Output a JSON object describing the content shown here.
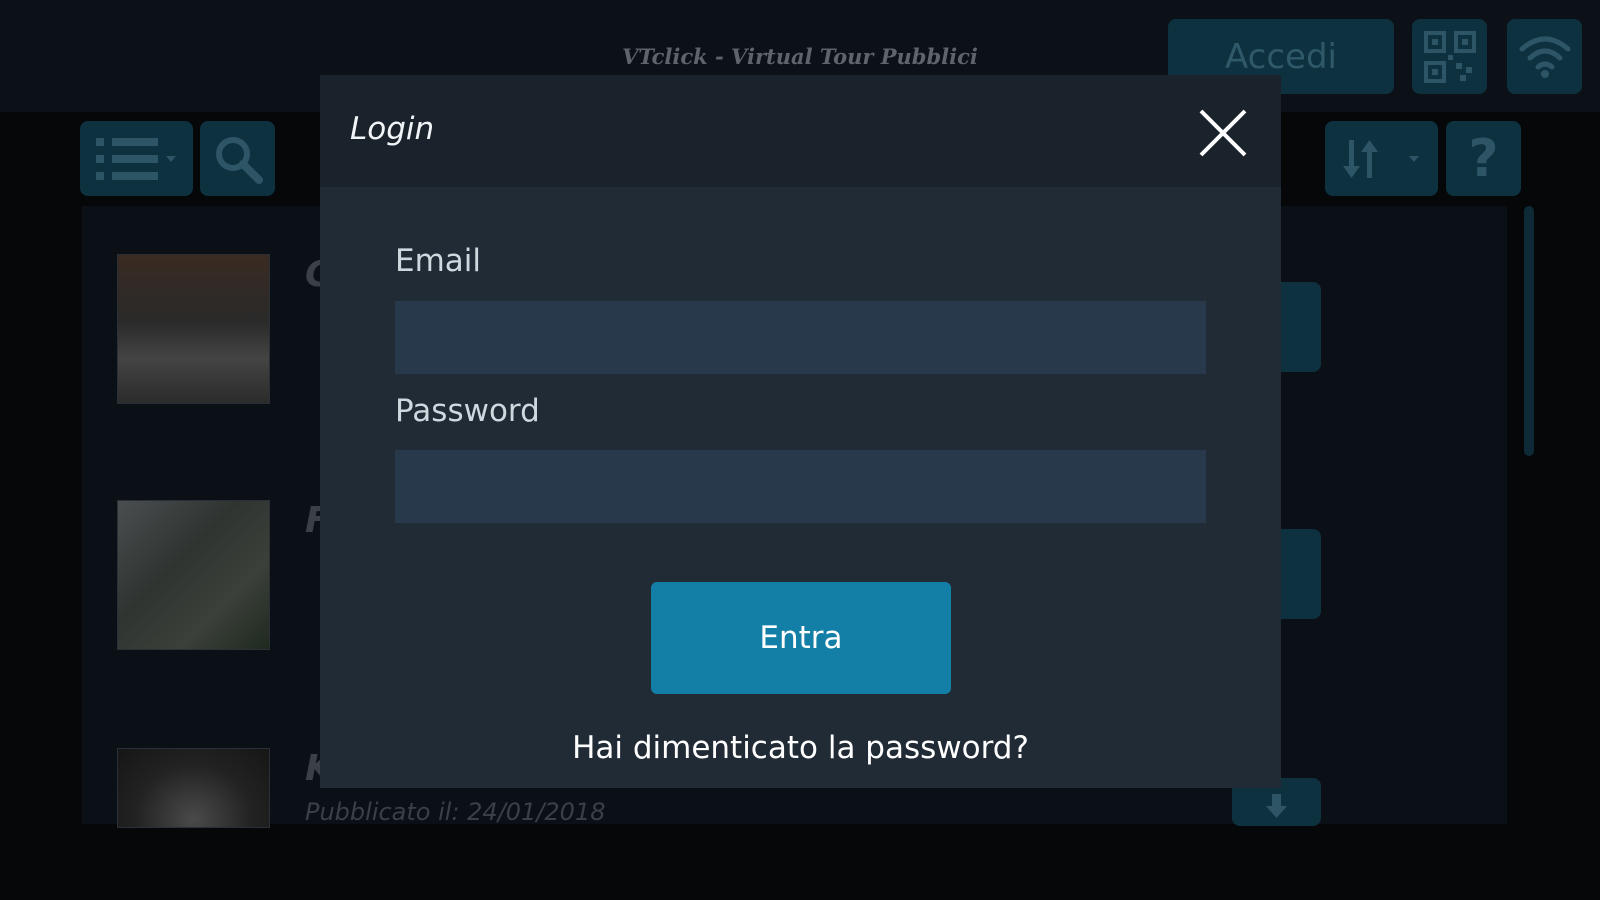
{
  "app": {
    "title": "VTclick - Virtual Tour Pubblici",
    "accedi_label": "Accedi",
    "help_label": "?",
    "rows": [
      {
        "title": "C",
        "date": ""
      },
      {
        "title": "F",
        "date": ""
      },
      {
        "title": "K",
        "date": "Pubblicato il: 24/01/2018"
      }
    ]
  },
  "modal": {
    "title": "Login",
    "email_label": "Email",
    "email_value": "",
    "password_label": "Password",
    "password_value": "",
    "submit_label": "Entra",
    "forgot_label": "Hai dimenticato la password?"
  },
  "colors": {
    "accent": "#137ea6",
    "modal_bg": "#202b35",
    "input_bg": "#27394a",
    "dim_button": "#0e3140"
  },
  "icons": [
    "list-icon",
    "search-icon",
    "sort-icon",
    "qr-code-icon",
    "wifi-icon",
    "close-icon",
    "download-icon"
  ]
}
